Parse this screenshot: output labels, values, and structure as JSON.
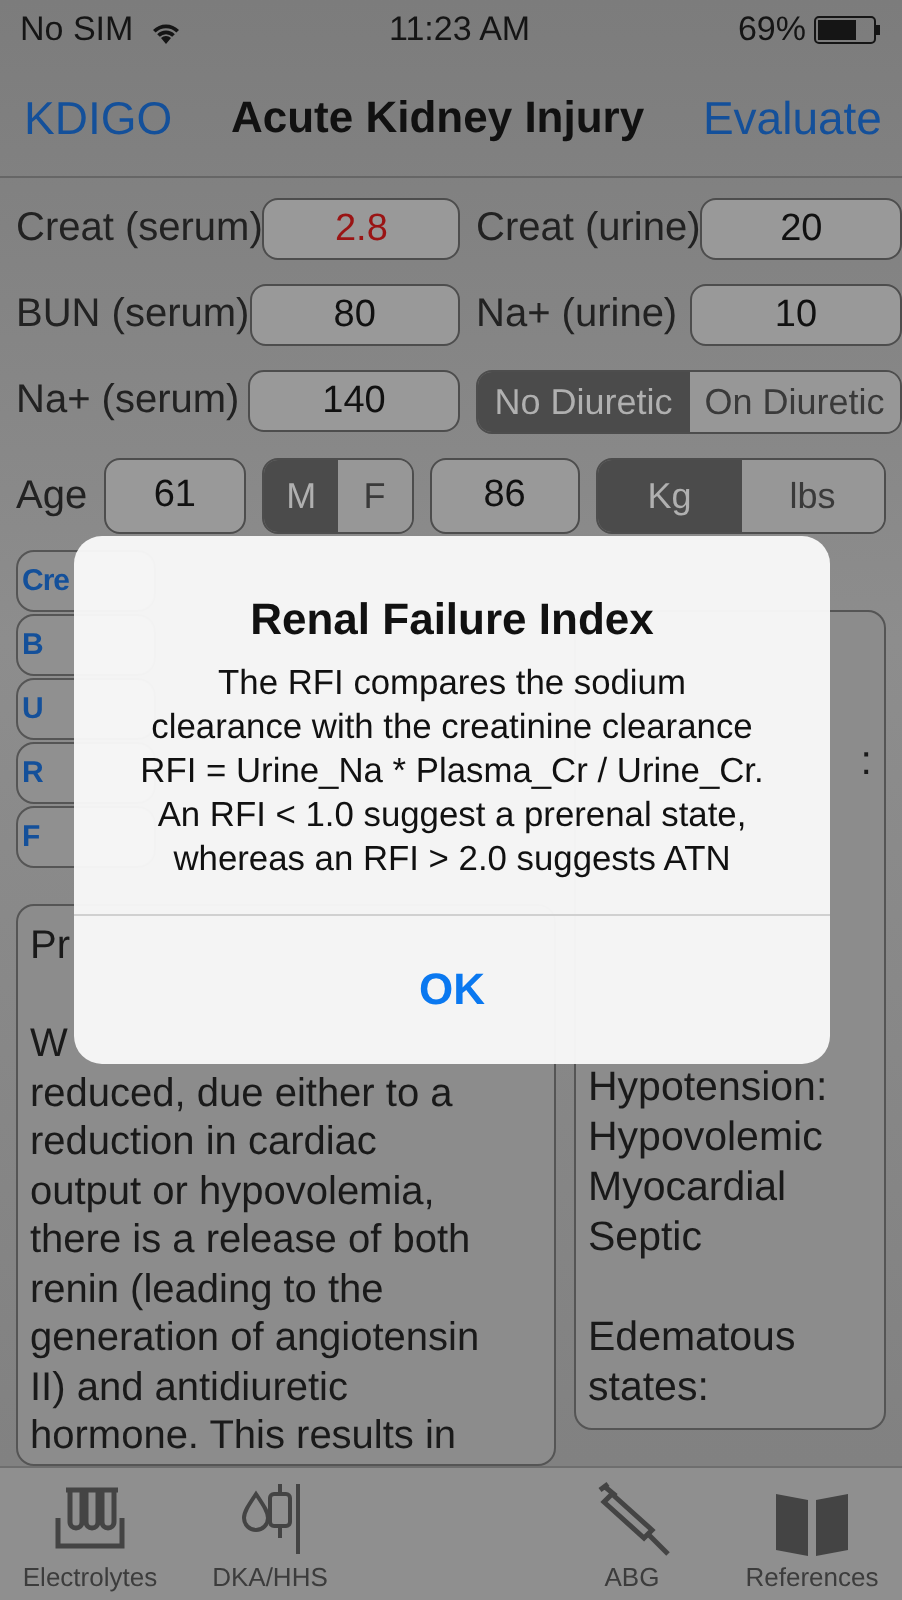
{
  "status_bar": {
    "carrier": "No SIM",
    "time": "11:23 AM",
    "battery": "69%"
  },
  "nav": {
    "left": "KDIGO",
    "title": "Acute Kidney Injury",
    "right": "Evaluate"
  },
  "inputs": [
    {
      "label": "Creat (serum)",
      "value": "2.8",
      "alert": true
    },
    {
      "label": "Creat (urine)",
      "value": "20",
      "alert": false
    },
    {
      "label": "BUN (serum)",
      "value": "80",
      "alert": false
    },
    {
      "label": "Na+ (urine)",
      "value": "10",
      "alert": false
    },
    {
      "label": "Na+ (serum)",
      "value": "140",
      "alert": false
    }
  ],
  "diuretic": [
    {
      "label": "No Diuretic",
      "selected": true
    },
    {
      "label": "On Diuretic",
      "selected": false
    }
  ],
  "age": {
    "label": "Age",
    "value": "61"
  },
  "sex": [
    {
      "label": "M",
      "selected": true
    },
    {
      "label": "F",
      "selected": false
    }
  ],
  "weight": {
    "value": "86"
  },
  "unit": [
    {
      "label": "Kg",
      "selected": true
    },
    {
      "label": "lbs",
      "selected": false
    }
  ],
  "chips": [
    "Cre",
    "B",
    "U",
    "R",
    "F"
  ],
  "left_panel": {
    "paragraphs": [
      [
        "Pr"
      ],
      [
        "W",
        "reduced, due either to a",
        "reduction in cardiac",
        "output or hypovolemia,",
        "there is a release of both",
        "renin (leading to the",
        "generation of angiotensin",
        "II) and antidiuretic",
        "hormone. This results in"
      ]
    ]
  },
  "right_panel": {
    "paragraphs": [
      [
        ":"
      ],
      [
        "Hypotension:",
        "Hypovolemic",
        "Myocardial",
        "Septic"
      ],
      [
        "Edematous",
        "states:"
      ]
    ]
  },
  "alert": {
    "title": "Renal Failure Index",
    "message": "The RFI compares the sodium\nclearance with the creatinine clearance\nRFI = Urine_Na * Plasma_Cr / Urine_Cr.\nAn RFI < 1.0 suggest a prerenal state,\nwhereas an RFI > 2.0 suggests ATN",
    "button": "OK"
  },
  "tabs": [
    {
      "label": "Electrolytes",
      "kind": "labs"
    },
    {
      "label": "DKA/HHS",
      "kind": "fluids"
    },
    {
      "label": "ABG",
      "kind": "blood-gas"
    },
    {
      "label": "References",
      "kind": "reading"
    }
  ]
}
